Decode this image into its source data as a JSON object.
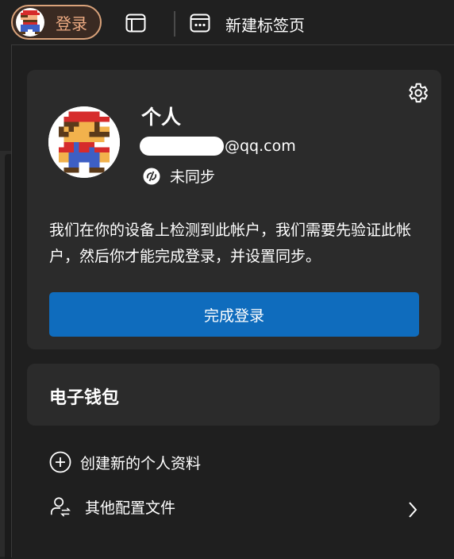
{
  "titlebar": {
    "profile_label": "登录",
    "new_tab_label": "新建标签页"
  },
  "account": {
    "name": "个人",
    "email_visible": "@qq.com",
    "sync_status": "未同步",
    "message": "我们在你的设备上检测到此帐户，我们需要先验证此帐户，然后你才能完成登录，并设置同步。",
    "primary_button": "完成登录"
  },
  "wallet": {
    "title": "电子钱包"
  },
  "menu": {
    "create_profile": "创建新的个人资料",
    "other_profiles": "其他配置文件"
  },
  "icons": [
    "pixel-avatar",
    "tab-icon",
    "new-tab-icon",
    "gear-icon",
    "sync-off-icon",
    "add-circle-icon",
    "profiles-switch-icon",
    "chevron-right-icon"
  ],
  "colors": {
    "accent_button": "#0f6cbd",
    "profile_button_border": "#d9a27a",
    "profile_button_text": "#ecaa82",
    "card_background": "#2b2b2b",
    "page_background": "#202020"
  }
}
